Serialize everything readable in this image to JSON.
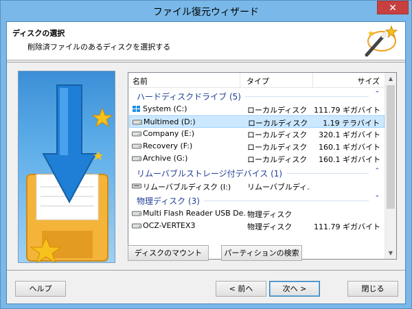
{
  "window": {
    "title": "ファイル復元ウィザード",
    "close_glyph": "✕"
  },
  "header": {
    "title": "ディスクの選択",
    "subtitle": "削除済ファイルのあるディスクを選択する",
    "icon": "magic-wand-icon"
  },
  "list": {
    "columns": {
      "name": "名前",
      "type": "タイプ",
      "size": "サイズ"
    },
    "groups": [
      {
        "label": "ハードディスクドライブ (5)",
        "items": [
          {
            "name": "System (C:)",
            "type": "ローカルディスク",
            "size": "111.79 ギガバイト",
            "icon": "windows-drive-icon"
          },
          {
            "name": "Multimed (D:)",
            "type": "ローカルディスク",
            "size": "1.19 テラバイト",
            "icon": "hard-drive-icon",
            "selected": true
          },
          {
            "name": "Company (E:)",
            "type": "ローカルディスク",
            "size": "320.1 ギガバイト",
            "icon": "hard-drive-icon"
          },
          {
            "name": "Recovery (F:)",
            "type": "ローカルディスク",
            "size": "160.1 ギガバイト",
            "icon": "hard-drive-icon"
          },
          {
            "name": "Archive (G:)",
            "type": "ローカルディスク",
            "size": "160.1 ギガバイト",
            "icon": "hard-drive-icon"
          }
        ]
      },
      {
        "label": "リムーバブルストレージ付デバイス (1)",
        "items": [
          {
            "name": "リムーバブルディスク (I:)",
            "type": "リムーバブルディ...",
            "size": "",
            "icon": "removable-drive-icon"
          }
        ]
      },
      {
        "label": "物理ディスク (3)",
        "items": [
          {
            "name": "Multi Flash Reader USB De...",
            "type": "物理ディスク",
            "size": "",
            "icon": "hard-drive-icon"
          },
          {
            "name": "OCZ-VERTEX3",
            "type": "物理ディスク",
            "size": "111.79 ギガバイト",
            "icon": "hard-drive-icon"
          }
        ]
      }
    ]
  },
  "actions": {
    "mount": "ディスクのマウント",
    "find_partitions": "パーティションの検索"
  },
  "footer": {
    "help": "ヘルプ",
    "back": "< 前へ",
    "next": "次へ >",
    "close": "閉じる"
  },
  "colors": {
    "accent": "#79b8e8",
    "group_text": "#1e3e96",
    "selection": "#cce8ff"
  }
}
